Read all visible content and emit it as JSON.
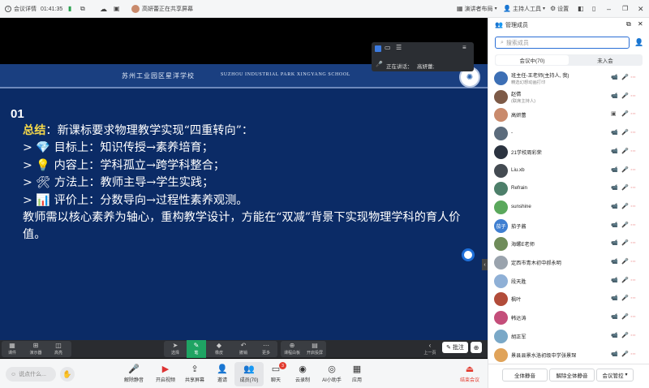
{
  "topbar": {
    "meeting_details": "会议详情",
    "timer": "01:41:35",
    "sharing_notice": "高妍蕾正在共享屏幕",
    "speaker_layout": "演讲者布局",
    "host_tools": "主持人工具",
    "settings": "设置"
  },
  "slide": {
    "school_cn": "苏州工业园区星洋学校",
    "school_en": "SUZHOU INDUSTRIAL PARK XINGYANG SCHOOL",
    "number": "01",
    "summary_label": "总结",
    "summary_text": "：新课标要求物理教学实现“四重转向”：",
    "points": [
      {
        "marker": "> ",
        "icon": "💎",
        "text": " 目标上：知识传授→素养培育；"
      },
      {
        "marker": "> ",
        "icon": "💡",
        "text": " 内容上：学科孤立→跨学科整合；"
      },
      {
        "marker": "> ",
        "icon": "🛠",
        "text": " 方法上：教师主导→学生实践；"
      },
      {
        "marker": "> ",
        "icon": "📊",
        "text": " 评价上：分数导向→过程性素养观测。"
      }
    ],
    "conclusion": "教师需以核心素养为轴心，重构教学设计，方能在“双减”背景下实现物理学科的育人价值。"
  },
  "sharebar": {
    "speaking_label": "正在讲话：",
    "speaker": "高妍蕾;"
  },
  "slide_tools": {
    "left": [
      "课件",
      "演示器",
      "高亮"
    ],
    "middle": [
      "选择",
      "笔",
      "橡皮",
      "撤销",
      "更多"
    ],
    "right": [
      "课程白板",
      "开启投屏"
    ],
    "prev": "上一页",
    "annotate": "批注"
  },
  "bottombar": {
    "chat_placeholder": "说点什么...",
    "buttons": [
      "解除静音",
      "开启视频",
      "共享屏幕",
      "邀请",
      "成员(70)",
      "聊天",
      "云录制",
      "AI小助手",
      "应用"
    ],
    "chat_badge": "3",
    "end": "结束会议"
  },
  "panel": {
    "title": "管理成员",
    "search_placeholder": "搜索成员",
    "tab_in": "会议中(70)",
    "tab_out": "未入会",
    "members": [
      {
        "name": "班主任-王老师(主持人, 我)",
        "sub": "精选幻想动画打印",
        "avatar": "#3d6fb5",
        "initial": "",
        "status": "muted"
      },
      {
        "name": "赵倩",
        "sub": "(联席主持人)",
        "avatar": "#7d5a47",
        "initial": "",
        "status": "muted"
      },
      {
        "name": "高妍蕾",
        "sub": "",
        "avatar": "#c98a6c",
        "initial": "",
        "status": "speaking"
      },
      {
        "name": "-",
        "sub": "",
        "avatar": "#5b6b7c",
        "initial": "",
        "status": "muted"
      },
      {
        "name": "21学校周彩荣",
        "sub": "",
        "avatar": "#2b3340",
        "initial": "",
        "status": "muted"
      },
      {
        "name": "Liu.xb",
        "sub": "",
        "avatar": "#444b52",
        "initial": "",
        "status": "muted"
      },
      {
        "name": "Refrain",
        "sub": "",
        "avatar": "#4d7f6a",
        "initial": "",
        "status": "muted"
      },
      {
        "name": "sunshine",
        "sub": "",
        "avatar": "#5aa85c",
        "initial": "",
        "status": "muted"
      },
      {
        "name": "茄子酱",
        "sub": "",
        "avatar": "#3f7fd1",
        "initial": "茄子",
        "status": "muted"
      },
      {
        "name": "海螺E老师",
        "sub": "",
        "avatar": "#6f8c5a",
        "initial": "",
        "status": "muted"
      },
      {
        "name": "定西市青木初中郝永明",
        "sub": "",
        "avatar": "#9aa3ad",
        "initial": "",
        "status": "muted"
      },
      {
        "name": "段天胜",
        "sub": "",
        "avatar": "#8fb0d6",
        "initial": "",
        "status": "muted"
      },
      {
        "name": "枫叶",
        "sub": "",
        "avatar": "#b24c3a",
        "initial": "",
        "status": "muted"
      },
      {
        "name": "韩达涛",
        "sub": "",
        "avatar": "#c44e7a",
        "initial": "",
        "status": "muted"
      },
      {
        "name": "胡正军",
        "sub": "",
        "avatar": "#7aa8c7",
        "initial": "",
        "status": "muted"
      },
      {
        "name": "景县县景水洛初级中学张景琛",
        "sub": "",
        "avatar": "#e0a35a",
        "initial": "",
        "status": "muted"
      }
    ],
    "mute_all": "全体静音",
    "unmute_all": "解除全体静音",
    "control": "会议管控"
  },
  "colors": {
    "accent": "#2b6fd6",
    "slide_bg": "#0b2b66",
    "highlight": "#f5d84a",
    "end_red": "#e23b2f"
  }
}
